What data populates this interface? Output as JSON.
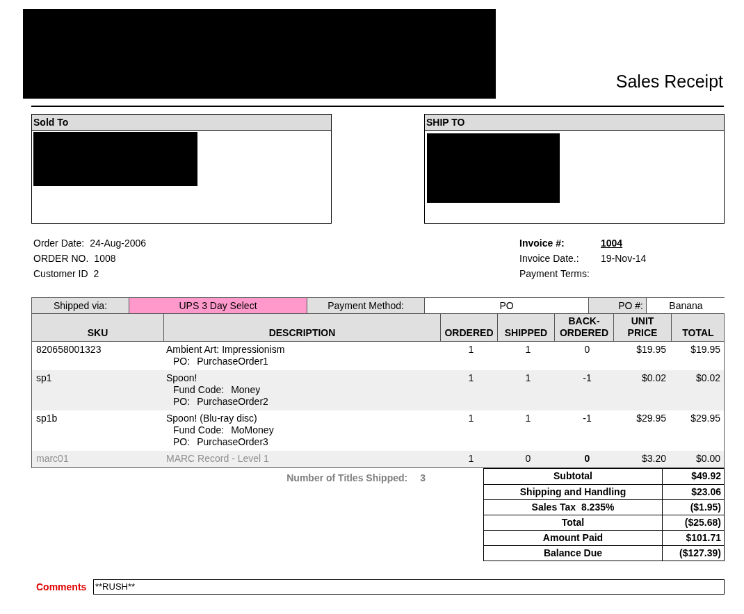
{
  "title": "Sales Receipt",
  "sold_to": {
    "heading": "Sold To"
  },
  "ship_to": {
    "heading": "SHIP TO"
  },
  "order_info": [
    {
      "label": "Order Date:",
      "value": "24-Aug-2006"
    },
    {
      "label": "ORDER NO.",
      "value": "1008"
    },
    {
      "label": "Customer ID",
      "value": "2"
    }
  ],
  "invoice_info": [
    {
      "label": "Invoice #:",
      "value": "1004",
      "kind": "emphasis"
    },
    {
      "label": "Invoice Date.:",
      "value": "19-Nov-14",
      "kind": "plain"
    },
    {
      "label": "Payment Terms:",
      "kind": "plain"
    }
  ],
  "shipping_bar": {
    "shipped_via_label": "Shipped via:",
    "shipped_via": {
      "value": "UPS 3 Day Select",
      "color": "#ff99cc"
    },
    "payment_method_label": "Payment Method:",
    "payment_method": "PO",
    "po_label": "PO #:",
    "po": "Banana"
  },
  "table": {
    "columns": [
      "SKU",
      "DESCRIPTION",
      "ORDERED",
      "SHIPPED",
      "BACK-ORDERED",
      "UNIT PRICE",
      "TOTAL"
    ],
    "rows": [
      {
        "sku": "820658001323",
        "description": "Ambient Art: Impressionism",
        "details": [
          {
            "label": "PO:",
            "value": "PurchaseOrder1"
          }
        ],
        "ordered": "1",
        "shipped": "1",
        "backordered": "0",
        "unit_price": "$19.95",
        "total": "$19.95",
        "greyed": false
      },
      {
        "sku": "sp1",
        "description": "Spoon!",
        "details": [
          {
            "label": "Fund Code:",
            "value": "Money"
          },
          {
            "label": "PO:",
            "value": "PurchaseOrder2"
          }
        ],
        "ordered": "1",
        "shipped": "1",
        "backordered": "-1",
        "unit_price": "$0.02",
        "total": "$0.02",
        "greyed": false
      },
      {
        "sku": "sp1b",
        "description": "Spoon! (Blu-ray disc)",
        "details": [
          {
            "label": "Fund Code:",
            "value": "MoMoney"
          },
          {
            "label": "PO:",
            "value": "PurchaseOrder3"
          }
        ],
        "ordered": "1",
        "shipped": "1",
        "backordered": "-1",
        "unit_price": "$29.95",
        "total": "$29.95",
        "greyed": false
      },
      {
        "sku": "marc01",
        "description": "MARC Record - Level 1",
        "ordered": "1",
        "shipped": "0",
        "backordered": "0",
        "unit_price": "$3.20",
        "total": "$0.00",
        "greyed": true
      }
    ]
  },
  "titles_shipped": {
    "label": "Number of Titles Shipped:",
    "value": "3"
  },
  "totals": [
    {
      "label": "Subtotal",
      "value": "$49.92"
    },
    {
      "label": "Shipping and Handling",
      "value": "$23.06"
    },
    {
      "label": "Sales Tax  8.235%",
      "value": "($1.95)"
    },
    {
      "label": "Total",
      "value": "($25.68)"
    },
    {
      "label": "Amount Paid",
      "value": "$101.71"
    },
    {
      "label": "Balance Due",
      "value": "($127.39)"
    }
  ],
  "comments": {
    "label": "Comments",
    "value": "**RUSH**"
  }
}
